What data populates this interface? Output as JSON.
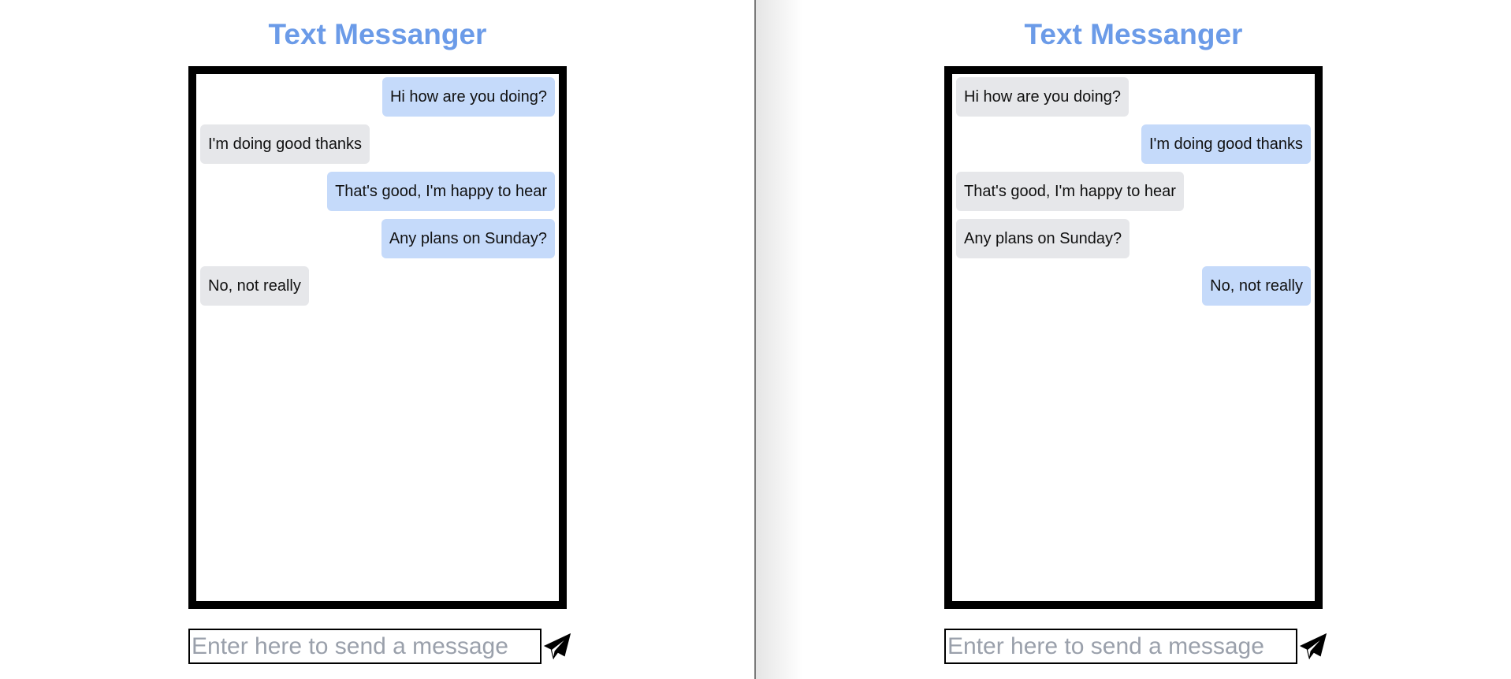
{
  "panes": [
    {
      "title": "Text Messanger",
      "messages": [
        {
          "text": "Hi how are you doing?",
          "side": "sent"
        },
        {
          "text": "I'm doing good thanks",
          "side": "received"
        },
        {
          "text": "That's good, I'm happy to hear",
          "side": "sent"
        },
        {
          "text": "Any plans on Sunday?",
          "side": "sent"
        },
        {
          "text": "No, not really",
          "side": "received"
        }
      ],
      "input": {
        "value": "",
        "placeholder": "Enter here to send a message"
      },
      "send_icon": "paper-plane-icon"
    },
    {
      "title": "Text Messanger",
      "messages": [
        {
          "text": "Hi how are you doing?",
          "side": "received"
        },
        {
          "text": "I'm doing good thanks",
          "side": "sent"
        },
        {
          "text": "That's good, I'm happy to hear",
          "side": "received"
        },
        {
          "text": "Any plans on Sunday?",
          "side": "received"
        },
        {
          "text": "No, not really",
          "side": "sent"
        }
      ],
      "input": {
        "value": "",
        "placeholder": "Enter here to send a message"
      },
      "send_icon": "paper-plane-icon"
    }
  ],
  "colors": {
    "title": "#6b9be8",
    "sent_bubble": "#c5dafa",
    "received_bubble": "#e6e7ea",
    "chat_border": "#000000",
    "placeholder": "#9aa0ab",
    "divider": "#7a7a7a"
  }
}
